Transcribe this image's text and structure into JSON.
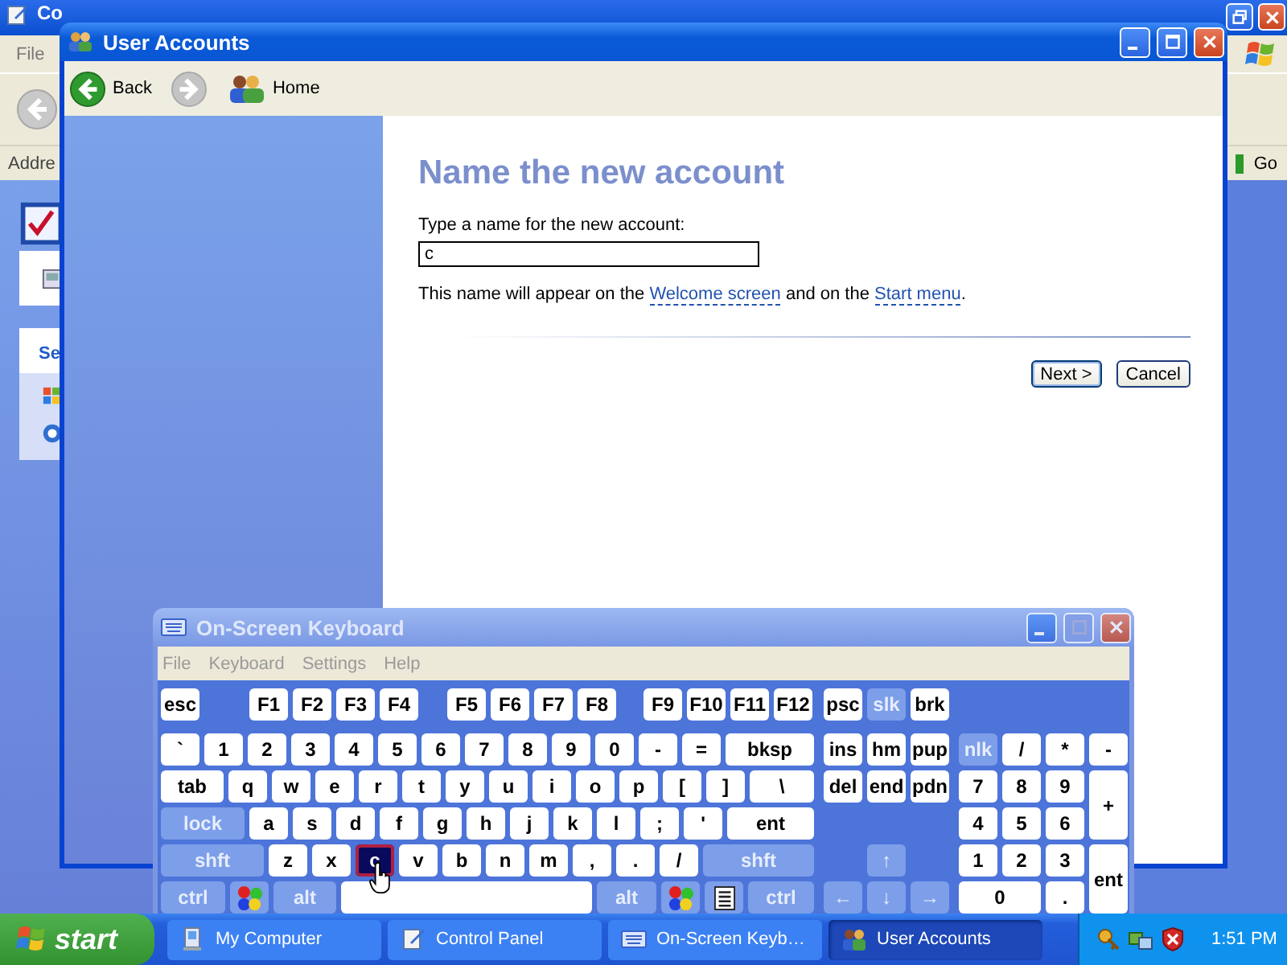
{
  "background_window": {
    "title": "Co",
    "menu": [
      "File"
    ],
    "address_label": "Addre",
    "go": "Go",
    "panel_heading": "Se"
  },
  "window": {
    "title": "User Accounts",
    "toolbar": [
      {
        "kind": "back",
        "label": "Back",
        "disabled": false
      },
      {
        "kind": "forward",
        "disabled": true
      },
      {
        "kind": "home",
        "label": "Home",
        "disabled": false
      }
    ],
    "heading": "Name the new account",
    "field_label": "Type a name for the new account:",
    "name_field": {
      "value": "c"
    },
    "note": [
      {
        "kind": "text",
        "text": "This name will appear on the "
      },
      {
        "kind": "link",
        "text": "Welcome screen"
      },
      {
        "kind": "text",
        "text": " and on the "
      },
      {
        "kind": "link",
        "text": "Start menu"
      },
      {
        "kind": "text",
        "text": "."
      }
    ],
    "buttons": [
      {
        "label": "Next >",
        "default": true
      },
      {
        "label": "Cancel",
        "default": false
      }
    ]
  },
  "keyboard": {
    "title": "On-Screen Keyboard",
    "menu": [
      "File",
      "Keyboard",
      "Settings",
      "Help"
    ],
    "function_keys": [
      {
        "label": "esc",
        "kind": "char",
        "pressed": false
      },
      {
        "label": "F1",
        "kind": "char",
        "pressed": false
      },
      {
        "label": "F2",
        "kind": "char",
        "pressed": false
      },
      {
        "label": "F3",
        "kind": "char",
        "pressed": false
      },
      {
        "label": "F4",
        "kind": "char",
        "pressed": false
      },
      {
        "label": "F5",
        "kind": "char",
        "pressed": false
      },
      {
        "label": "F6",
        "kind": "char",
        "pressed": false
      },
      {
        "label": "F7",
        "kind": "char",
        "pressed": false
      },
      {
        "label": "F8",
        "kind": "char",
        "pressed": false
      },
      {
        "label": "F9",
        "kind": "char",
        "pressed": false
      },
      {
        "label": "F10",
        "kind": "char",
        "pressed": false
      },
      {
        "label": "F11",
        "kind": "char",
        "pressed": false
      },
      {
        "label": "F12",
        "kind": "char",
        "pressed": false
      }
    ],
    "number_row": [
      {
        "label": "`",
        "kind": "char",
        "pressed": false
      },
      {
        "label": "1",
        "kind": "char",
        "pressed": false
      },
      {
        "label": "2",
        "kind": "char",
        "pressed": false
      },
      {
        "label": "3",
        "kind": "char",
        "pressed": false
      },
      {
        "label": "4",
        "kind": "char",
        "pressed": false
      },
      {
        "label": "5",
        "kind": "char",
        "pressed": false
      },
      {
        "label": "6",
        "kind": "char",
        "pressed": false
      },
      {
        "label": "7",
        "kind": "char",
        "pressed": false
      },
      {
        "label": "8",
        "kind": "char",
        "pressed": false
      },
      {
        "label": "9",
        "kind": "char",
        "pressed": false
      },
      {
        "label": "0",
        "kind": "char",
        "pressed": false
      },
      {
        "label": "-",
        "kind": "char",
        "pressed": false
      },
      {
        "label": "=",
        "kind": "char",
        "pressed": false
      },
      {
        "label": "bksp",
        "kind": "char",
        "pressed": false
      }
    ],
    "top_row": [
      {
        "label": "tab",
        "kind": "char",
        "pressed": false
      },
      {
        "label": "q",
        "kind": "char",
        "pressed": false
      },
      {
        "label": "w",
        "kind": "char",
        "pressed": false
      },
      {
        "label": "e",
        "kind": "char",
        "pressed": false
      },
      {
        "label": "r",
        "kind": "char",
        "pressed": false
      },
      {
        "label": "t",
        "kind": "char",
        "pressed": false
      },
      {
        "label": "y",
        "kind": "char",
        "pressed": false
      },
      {
        "label": "u",
        "kind": "char",
        "pressed": false
      },
      {
        "label": "i",
        "kind": "char",
        "pressed": false
      },
      {
        "label": "o",
        "kind": "char",
        "pressed": false
      },
      {
        "label": "p",
        "kind": "char",
        "pressed": false
      },
      {
        "label": "[",
        "kind": "char",
        "pressed": false
      },
      {
        "label": "]",
        "kind": "char",
        "pressed": false
      },
      {
        "label": "\\",
        "kind": "char",
        "pressed": false
      }
    ],
    "home_row": [
      {
        "label": "lock",
        "kind": "mod",
        "pressed": false
      },
      {
        "label": "a",
        "kind": "char",
        "pressed": false
      },
      {
        "label": "s",
        "kind": "char",
        "pressed": false
      },
      {
        "label": "d",
        "kind": "char",
        "pressed": false
      },
      {
        "label": "f",
        "kind": "char",
        "pressed": false
      },
      {
        "label": "g",
        "kind": "char",
        "pressed": false
      },
      {
        "label": "h",
        "kind": "char",
        "pressed": false
      },
      {
        "label": "j",
        "kind": "char",
        "pressed": false
      },
      {
        "label": "k",
        "kind": "char",
        "pressed": false
      },
      {
        "label": "l",
        "kind": "char",
        "pressed": false
      },
      {
        "label": ";",
        "kind": "char",
        "pressed": false
      },
      {
        "label": "'",
        "kind": "char",
        "pressed": false
      },
      {
        "label": "ent",
        "kind": "char",
        "pressed": false
      }
    ],
    "bottom_row": [
      {
        "label": "shft",
        "kind": "mod",
        "pressed": false
      },
      {
        "label": "z",
        "kind": "char",
        "pressed": false
      },
      {
        "label": "x",
        "kind": "char",
        "pressed": false
      },
      {
        "label": "c",
        "kind": "char",
        "pressed": true
      },
      {
        "label": "v",
        "kind": "char",
        "pressed": false
      },
      {
        "label": "b",
        "kind": "char",
        "pressed": false
      },
      {
        "label": "n",
        "kind": "char",
        "pressed": false
      },
      {
        "label": "m",
        "kind": "char",
        "pressed": false
      },
      {
        "label": ",",
        "kind": "char",
        "pressed": false
      },
      {
        "label": ".",
        "kind": "char",
        "pressed": false
      },
      {
        "label": "/",
        "kind": "char",
        "pressed": false
      },
      {
        "label": "shft",
        "kind": "mod",
        "pressed": false
      }
    ],
    "space_row": [
      {
        "label": "ctrl",
        "kind": "mod",
        "pressed": false
      },
      {
        "kind": "logo",
        "pressed": false
      },
      {
        "label": "alt",
        "kind": "mod",
        "pressed": false
      },
      {
        "kind": "space",
        "pressed": false
      },
      {
        "label": "alt",
        "kind": "mod",
        "pressed": false
      },
      {
        "kind": "logo",
        "pressed": false
      },
      {
        "kind": "menu",
        "pressed": false
      },
      {
        "label": "ctrl",
        "kind": "mod",
        "pressed": false
      }
    ],
    "nav": [
      {
        "label": "psc",
        "kind": "char",
        "pressed": false
      },
      {
        "label": "slk",
        "kind": "mod",
        "pressed": false
      },
      {
        "label": "brk",
        "kind": "char",
        "pressed": false
      },
      {
        "label": "ins",
        "kind": "char",
        "pressed": false
      },
      {
        "label": "hm",
        "kind": "char",
        "pressed": false
      },
      {
        "label": "pup",
        "kind": "char",
        "pressed": false
      },
      {
        "label": "del",
        "kind": "char",
        "pressed": false
      },
      {
        "label": "end",
        "kind": "char",
        "pressed": false
      },
      {
        "label": "pdn",
        "kind": "char",
        "pressed": false
      },
      {
        "label": "↑",
        "kind": "mod",
        "pressed": false
      },
      {
        "label": "←",
        "kind": "mod",
        "pressed": false
      },
      {
        "label": "↓",
        "kind": "mod",
        "pressed": false
      },
      {
        "label": "→",
        "kind": "mod",
        "pressed": false
      }
    ],
    "numpad": [
      {
        "label": "nlk",
        "kind": "mod",
        "pressed": false
      },
      {
        "label": "/",
        "kind": "char",
        "pressed": false
      },
      {
        "label": "*",
        "kind": "char",
        "pressed": false
      },
      {
        "label": "-",
        "kind": "char",
        "pressed": false
      },
      {
        "label": "7",
        "kind": "char",
        "pressed": false
      },
      {
        "label": "8",
        "kind": "char",
        "pressed": false
      },
      {
        "label": "9",
        "kind": "char",
        "pressed": false
      },
      {
        "label": "+",
        "kind": "char",
        "pressed": false
      },
      {
        "label": "4",
        "kind": "char",
        "pressed": false
      },
      {
        "label": "5",
        "kind": "char",
        "pressed": false
      },
      {
        "label": "6",
        "kind": "char",
        "pressed": false
      },
      {
        "label": "1",
        "kind": "char",
        "pressed": false
      },
      {
        "label": "2",
        "kind": "char",
        "pressed": false
      },
      {
        "label": "3",
        "kind": "char",
        "pressed": false
      },
      {
        "label": "ent",
        "kind": "char",
        "pressed": false
      },
      {
        "label": "0",
        "kind": "char",
        "pressed": false
      },
      {
        "label": ".",
        "kind": "char",
        "pressed": false
      }
    ]
  },
  "taskbar": {
    "start": "start",
    "tasks": [
      {
        "kind": "computer",
        "label": "My Computer",
        "selected": false
      },
      {
        "kind": "control_panel",
        "label": "Control Panel",
        "selected": false
      },
      {
        "kind": "keyboard",
        "label": "On-Screen Keyb…",
        "selected": false
      },
      {
        "kind": "users",
        "label": "User Accounts",
        "selected": true
      }
    ],
    "clock": "1:51 PM"
  }
}
